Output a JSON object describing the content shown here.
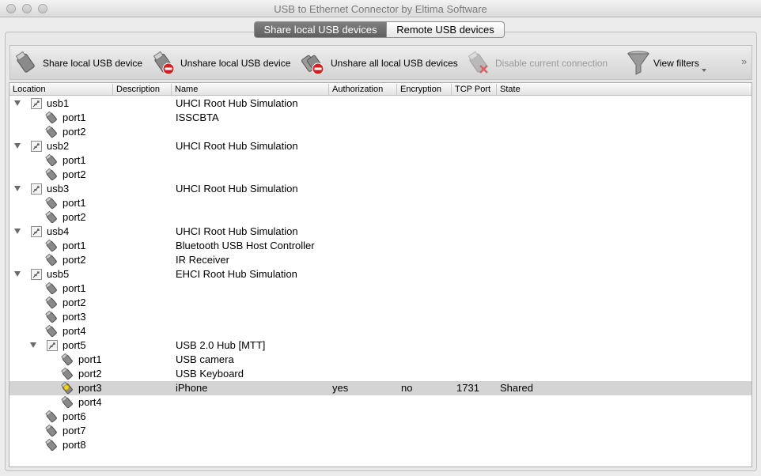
{
  "window": {
    "title": "USB to Ethernet Connector by Eltima Software"
  },
  "tabs": [
    {
      "label": "Share local USB devices",
      "active": true
    },
    {
      "label": "Remote USB devices",
      "active": false
    }
  ],
  "toolbar": {
    "share_label": "Share local USB device",
    "unshare_label": "Unshare local USB device",
    "unshare_all_label": "Unshare all local USB devices",
    "disable_label": "Disable current connection",
    "filters_label": "View filters",
    "more": "»"
  },
  "columns": {
    "location": "Location",
    "description": "Description",
    "name": "Name",
    "authorization": "Authorization",
    "encryption": "Encryption",
    "tcp_port": "TCP Port",
    "state": "State"
  },
  "rows": [
    {
      "level": 0,
      "expandable": true,
      "icon": "usb-hub-icon",
      "location": "usb1",
      "name": "UHCI Root Hub Simulation"
    },
    {
      "level": 1,
      "expandable": false,
      "icon": "usb-plug-icon",
      "location": "port1",
      "name": "ISSCBTA"
    },
    {
      "level": 1,
      "expandable": false,
      "icon": "usb-plug-icon",
      "location": "port2",
      "name": ""
    },
    {
      "level": 0,
      "expandable": true,
      "icon": "usb-hub-icon",
      "location": "usb2",
      "name": "UHCI Root Hub Simulation"
    },
    {
      "level": 1,
      "expandable": false,
      "icon": "usb-plug-icon",
      "location": "port1",
      "name": ""
    },
    {
      "level": 1,
      "expandable": false,
      "icon": "usb-plug-icon",
      "location": "port2",
      "name": ""
    },
    {
      "level": 0,
      "expandable": true,
      "icon": "usb-hub-icon",
      "location": "usb3",
      "name": "UHCI Root Hub Simulation"
    },
    {
      "level": 1,
      "expandable": false,
      "icon": "usb-plug-icon",
      "location": "port1",
      "name": ""
    },
    {
      "level": 1,
      "expandable": false,
      "icon": "usb-plug-icon",
      "location": "port2",
      "name": ""
    },
    {
      "level": 0,
      "expandable": true,
      "icon": "usb-hub-icon",
      "location": "usb4",
      "name": "UHCI Root Hub Simulation"
    },
    {
      "level": 1,
      "expandable": false,
      "icon": "usb-plug-icon",
      "location": "port1",
      "name": "Bluetooth USB Host Controller"
    },
    {
      "level": 1,
      "expandable": false,
      "icon": "usb-plug-icon",
      "location": "port2",
      "name": "IR Receiver"
    },
    {
      "level": 0,
      "expandable": true,
      "icon": "usb-hub-icon",
      "location": "usb5",
      "name": "EHCI Root Hub Simulation"
    },
    {
      "level": 1,
      "expandable": false,
      "icon": "usb-plug-icon",
      "location": "port1",
      "name": ""
    },
    {
      "level": 1,
      "expandable": false,
      "icon": "usb-plug-icon",
      "location": "port2",
      "name": ""
    },
    {
      "level": 1,
      "expandable": false,
      "icon": "usb-plug-icon",
      "location": "port3",
      "name": ""
    },
    {
      "level": 1,
      "expandable": false,
      "icon": "usb-plug-icon",
      "location": "port4",
      "name": ""
    },
    {
      "level": 1,
      "expandable": true,
      "icon": "usb-hub-icon",
      "location": "port5",
      "name": "USB 2.0 Hub [MTT]"
    },
    {
      "level": 2,
      "expandable": false,
      "icon": "usb-plug-icon",
      "location": "port1",
      "name": "USB camera"
    },
    {
      "level": 2,
      "expandable": false,
      "icon": "usb-plug-icon",
      "location": "port2",
      "name": "USB Keyboard"
    },
    {
      "level": 2,
      "expandable": false,
      "icon": "usb-shared-icon",
      "location": "port3",
      "name": "iPhone",
      "authorization": "yes",
      "encryption": "no",
      "tcp_port": "1731",
      "state": "Shared",
      "selected": true
    },
    {
      "level": 2,
      "expandable": false,
      "icon": "usb-plug-icon",
      "location": "port4",
      "name": ""
    },
    {
      "level": 1,
      "expandable": false,
      "icon": "usb-plug-icon",
      "location": "port6",
      "name": ""
    },
    {
      "level": 1,
      "expandable": false,
      "icon": "usb-plug-icon",
      "location": "port7",
      "name": ""
    },
    {
      "level": 1,
      "expandable": false,
      "icon": "usb-plug-icon",
      "location": "port8",
      "name": ""
    }
  ]
}
